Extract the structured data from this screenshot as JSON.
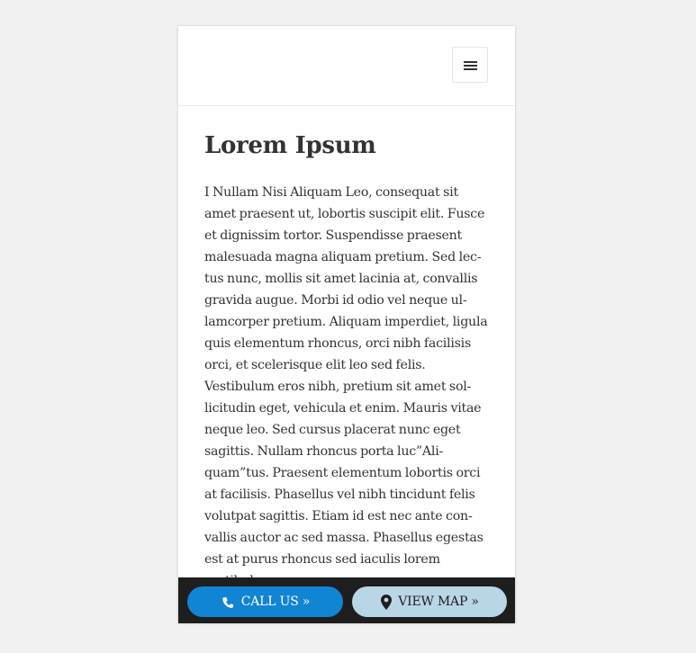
{
  "header": {
    "menu_icon": "hamburger-menu-icon"
  },
  "main": {
    "title": "Lorem Ipsum",
    "body": "I Nullam Nisi Aliquam Leo, consequat sit amet praesent ut, lobortis suscipit elit. Fusce et dignissim tortor. Suspendisse praesent malesuada magna aliquam pretium. Sed lec­tus nunc, mollis sit amet lacinia at, convallis gravida augue. Morbi id odio vel neque ul­lamcorper pretium. Aliquam imperdiet, ligula quis elementum rhoncus, orci nibh fa­cilisis orci, et scelerisque elit leo sed felis. Vestibulum eros nibh, pretium sit amet sol­licitudin eget, vehicula et enim. Mauris vi­tae neque leo. Sed cursus placerat nunc eget sagittis. Nullam rhoncus porta luc”Ali­quam”tus. Praesent elementum lobortis orci at facilisis. Phasellus vel nibh tincidunt felis volutpat sagittis. Etiam id est nec ante con­vallis auctor ac sed massa. Phasellus egestas est at purus rhoncus sed iaculis lorem vestibulum."
  },
  "cta_bar": {
    "call_label": "CALL US »",
    "call_icon": "phone-icon",
    "map_label": "VIEW MAP »",
    "map_icon": "map-pin-icon"
  },
  "colors": {
    "page_background": "#f1f1f1",
    "call_button": "#1185d3",
    "map_button": "#b9d6e6",
    "cta_bar": "#1e1e1e",
    "text": "#333333"
  }
}
